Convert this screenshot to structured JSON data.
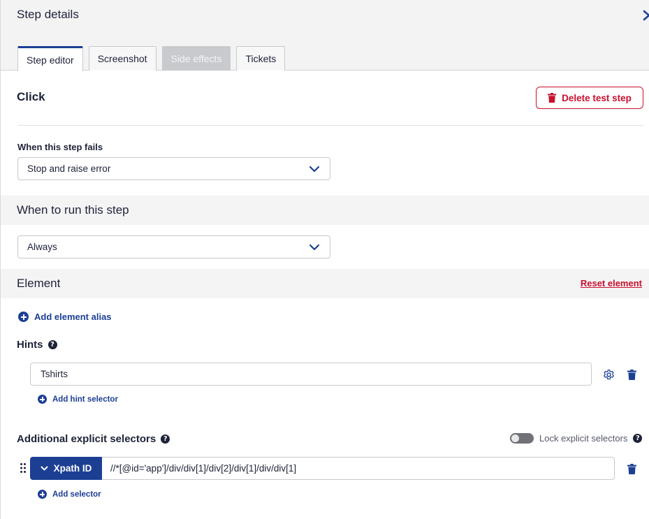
{
  "header": {
    "title": "Step details",
    "close_icon": "close-chevron-icon"
  },
  "tabs": [
    {
      "label": "Step editor",
      "state": "active"
    },
    {
      "label": "Screenshot",
      "state": "normal"
    },
    {
      "label": "Side effects",
      "state": "disabled"
    },
    {
      "label": "Tickets",
      "state": "normal"
    }
  ],
  "step": {
    "name": "Click",
    "delete_label": "Delete test step"
  },
  "on_fail": {
    "label": "When this step fails",
    "value": "Stop and raise error"
  },
  "when_to_run": {
    "title": "When to run this step",
    "value": "Always"
  },
  "element": {
    "title": "Element",
    "reset_label": "Reset element",
    "add_alias_label": "Add element alias"
  },
  "hints": {
    "title": "Hints",
    "value": "Tshirts",
    "add_label": "Add hint selector"
  },
  "selectors": {
    "title": "Additional explicit selectors",
    "lock_label": "Lock explicit selectors",
    "lock_enabled": false,
    "type_label": "Xpath ID",
    "value": "//*[@id='app']/div/div[1]/div[2]/div[1]/div/div[1]",
    "add_label": "Add selector"
  },
  "colors": {
    "primary": "#1c3f94",
    "danger": "#c8102e",
    "text": "#1e2238",
    "section_band": "#f4f4f5"
  }
}
